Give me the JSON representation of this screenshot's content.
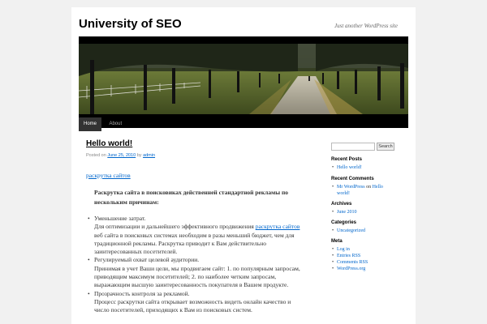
{
  "site": {
    "title": "University of SEO",
    "description": "Just another WordPress site"
  },
  "menu": [
    {
      "label": "Home",
      "current": true
    },
    {
      "label": "About",
      "current": false
    }
  ],
  "post": {
    "title": "Hello world!",
    "meta": {
      "posted_on": "Posted on",
      "date": "June 25, 2010",
      "by": "by",
      "author": "admin"
    },
    "lead_link": "раскрутка сайтов",
    "strong_paragraph": "Раскрутка сайта в поисковиках действенней стандартной рекламы по нескольким причинам:",
    "reasons": [
      {
        "title": "Уменьшение затрат.",
        "text_before": "Для оптимизации и дальнейшего эффективного продвижения ",
        "link": "раскрутка сайтов",
        "text_after": " веб сайта в поисковых системах необходим в разы меньший бюджет, чем для традиционной рекламы. Раскрутка приводит к Вам действительно заинтересованных посетителей."
      },
      {
        "title": "Регулируемый охват целевой аудитории.",
        "text_before": "Принимая в учет Ваши цели, мы продвигаем сайт: 1. по популярным запросам, приводящим максимум посетителей; 2. по наиболее четким запросам, выражающим высшую заинтересованность покупателя в Вашем продукте.",
        "link": "",
        "text_after": ""
      },
      {
        "title": "Прозрачность контроля за рекламой.",
        "text_before": "Процесс раскрутки сайта открывает возможность видеть онлайн качество и число посетителей, приходящих к Вам из поисковых систем.",
        "link": "",
        "text_after": ""
      }
    ]
  },
  "sidebar": {
    "search_button": "Search",
    "search_value": "",
    "widgets": [
      {
        "title": "Recent Posts",
        "items": [
          {
            "before": "",
            "link": "Hello world!",
            "after": ""
          }
        ]
      },
      {
        "title": "Recent Comments",
        "items": [
          {
            "before": "",
            "link": "Mr WordPress",
            "after": " on ",
            "link2": "Hello world!"
          }
        ]
      },
      {
        "title": "Archives",
        "items": [
          {
            "before": "",
            "link": "June 2010",
            "after": ""
          }
        ]
      },
      {
        "title": "Categories",
        "items": [
          {
            "before": "",
            "link": "Uncategorized",
            "after": ""
          }
        ]
      },
      {
        "title": "Meta",
        "items": [
          {
            "before": "",
            "link": "Log in",
            "after": ""
          },
          {
            "before": "",
            "link": "Entries RSS",
            "after": ""
          },
          {
            "before": "",
            "link": "Comments RSS",
            "after": ""
          },
          {
            "before": "",
            "link": "WordPress.org",
            "after": ""
          }
        ]
      }
    ]
  }
}
